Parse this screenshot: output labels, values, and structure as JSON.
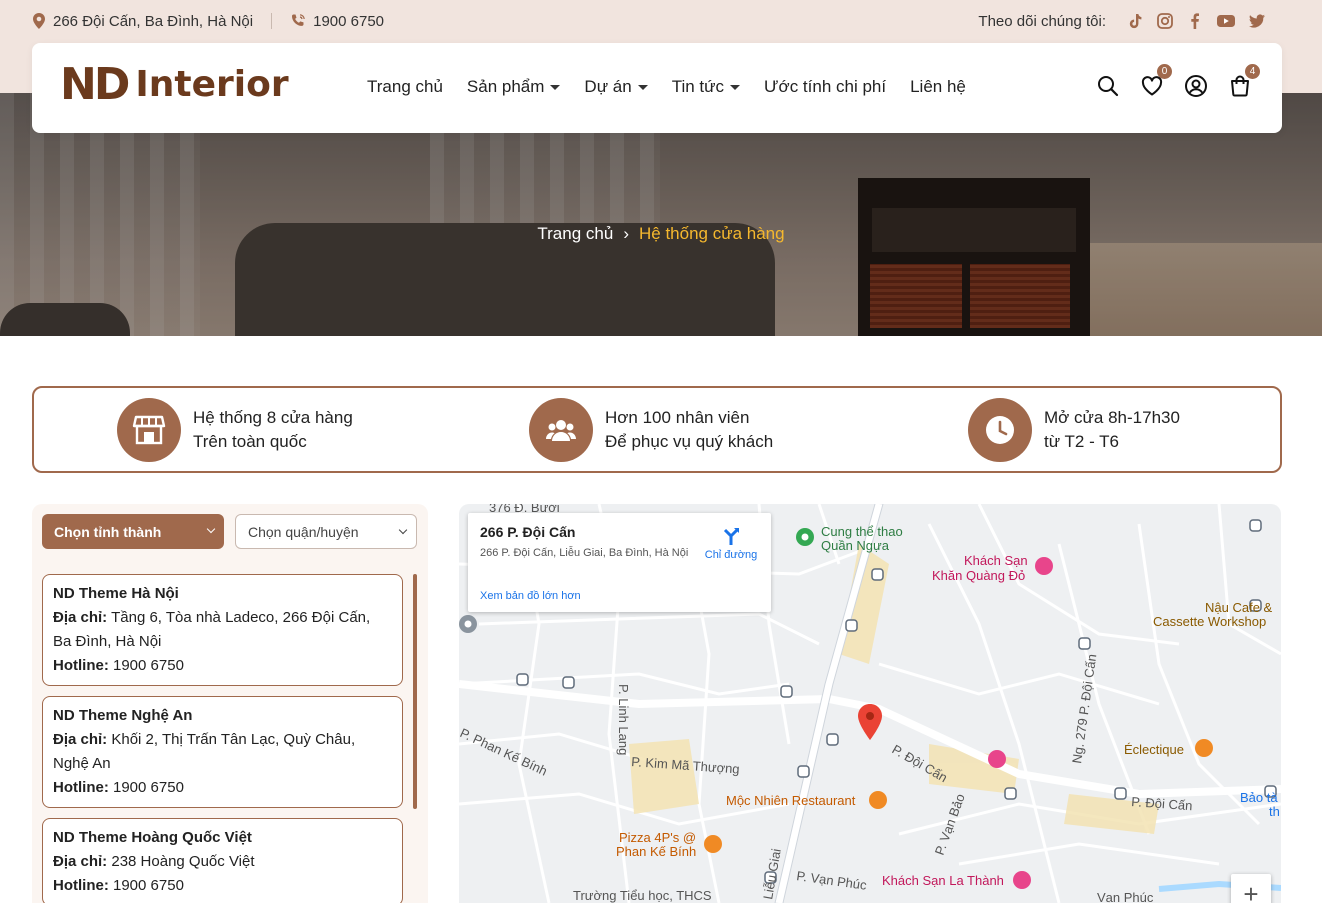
{
  "topbar": {
    "address": "266 Đội Cấn, Ba Đình, Hà Nội",
    "phone": "1900 6750",
    "follow_label": "Theo dõi chúng tôi:",
    "social_icons": [
      "tiktok-icon",
      "instagram-icon",
      "facebook-icon",
      "youtube-icon",
      "twitter-icon"
    ]
  },
  "header": {
    "logo_mark": "ND",
    "logo_text": "Interior",
    "nav": [
      {
        "label": "Trang chủ",
        "has_dropdown": false
      },
      {
        "label": "Sản phẩm",
        "has_dropdown": true
      },
      {
        "label": "Dự án",
        "has_dropdown": true
      },
      {
        "label": "Tin tức",
        "has_dropdown": true
      },
      {
        "label": "Ước tính chi phí",
        "has_dropdown": false
      },
      {
        "label": "Liên hệ",
        "has_dropdown": false
      }
    ],
    "wishlist_count": "0",
    "cart_count": "4"
  },
  "breadcrumb": {
    "home": "Trang chủ",
    "separator": "›",
    "current": "Hệ thống cửa hàng"
  },
  "features": [
    {
      "icon": "store-icon",
      "line1": "Hệ thống 8 cửa hàng",
      "line2": "Trên toàn quốc"
    },
    {
      "icon": "users-icon",
      "line1": "Hơn 100 nhân viên",
      "line2": "Để phục vụ quý khách"
    },
    {
      "icon": "clock-icon",
      "line1": "Mở cửa 8h-17h30",
      "line2": "từ T2 - T6"
    }
  ],
  "filters": {
    "province_label": "Chọn tỉnh thành",
    "district_label": "Chọn quận/huyện"
  },
  "stores": [
    {
      "name": "ND Theme Hà Nội",
      "address_label": "Địa chỉ:",
      "address": "Tầng 6, Tòa nhà Ladeco, 266 Đội Cấn, Ba Đình, Hà Nội",
      "hotline_label": "Hotline:",
      "hotline": "1900 6750"
    },
    {
      "name": "ND Theme Nghệ An",
      "address_label": "Địa chỉ:",
      "address": "Khối 2, Thị Trấn Tân Lạc, Quỳ Châu, Nghệ An",
      "hotline_label": "Hotline:",
      "hotline": "1900 6750"
    },
    {
      "name": "ND Theme Hoàng Quốc Việt",
      "address_label": "Địa chỉ:",
      "address": "238 Hoàng Quốc Việt",
      "hotline_label": "Hotline:",
      "hotline": "1900 6750"
    }
  ],
  "map": {
    "info_title": "266 P. Đội Cấn",
    "info_address": "266 P. Đội Cấn, Liễu Giai, Ba Đình, Hà Nội",
    "directions_label": "Chỉ đường",
    "bigger_map_label": "Xem bản đồ lớn hơn",
    "zoom_in": "+",
    "labels": [
      "376 Đ. Bưởi",
      "Cung thể thao Quần Ngựa",
      "Khách Sạn Khăn Quàng Đỏ",
      "Nậu Cafe & Cassette Workshop",
      "P. Linh Lang",
      "P. Phan Kế Bính",
      "P. Kim Mã Thượng",
      "P. Đội Cấn",
      "Ng. 279 P. Đội Cấn",
      "Éclectique",
      "Bảo tà th",
      "Mộc Nhiên Restaurant",
      "Pizza 4P's @ Phan Kế Bính",
      "P. Vạn Bảo",
      "Khách Sạn La Thành",
      "P. Vạn Phúc",
      "Liễu Giai",
      "Trường Tiểu học, THCS",
      "Vạn Phúc"
    ],
    "colors": {
      "road_major": "#f3e3b3",
      "road": "#ffffff",
      "water": "#aadaff",
      "marker": "#ea4335",
      "poi_hotel": "#e8458b",
      "poi_food": "#f08a24",
      "poi_park": "#34a853",
      "transit": "#5f6b7a"
    }
  },
  "colors": {
    "brand": "#a0694c",
    "accent": "#f5b82e",
    "topbar_bg": "#f1e4de",
    "logo": "#6b3a1d"
  }
}
